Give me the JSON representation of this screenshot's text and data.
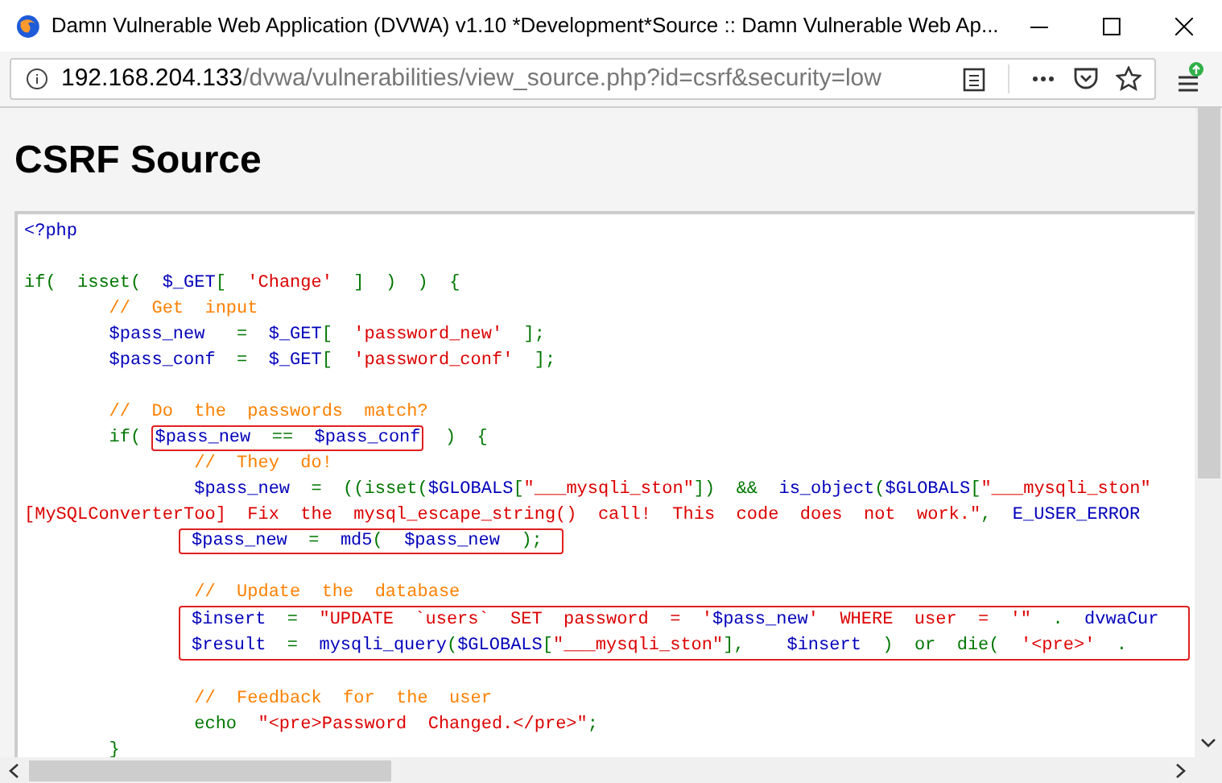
{
  "window": {
    "title": "Damn Vulnerable Web Application (DVWA) v1.10 *Development*Source :: Damn Vulnerable Web Ap..."
  },
  "address_bar": {
    "host": "192.168.204.133",
    "path": "/dvwa/vulnerabilities/view_source.php?id=csrf&security=low"
  },
  "page": {
    "heading": "CSRF Source",
    "code_lines": [
      {
        "kind": "line",
        "tokens": [
          {
            "text": "<?php",
            "kind": "default"
          }
        ]
      },
      {
        "kind": "blank"
      },
      {
        "kind": "line",
        "tokens": [
          {
            "text": "if(  isset(  ",
            "kind": "keyword"
          },
          {
            "text": "$_GET",
            "kind": "default"
          },
          {
            "text": "[  ",
            "kind": "keyword"
          },
          {
            "text": "'Change'",
            "kind": "string"
          },
          {
            "text": "  ]  )  )  {",
            "kind": "keyword"
          }
        ]
      },
      {
        "kind": "line",
        "tokens": [
          {
            "text": "        //  Get  input",
            "kind": "comment"
          }
        ]
      },
      {
        "kind": "line",
        "tokens": [
          {
            "text": "        $pass_new   ",
            "kind": "default"
          },
          {
            "text": "=  ",
            "kind": "keyword"
          },
          {
            "text": "$_GET",
            "kind": "default"
          },
          {
            "text": "[  ",
            "kind": "keyword"
          },
          {
            "text": "'password_new'",
            "kind": "string"
          },
          {
            "text": "  ];",
            "kind": "keyword"
          }
        ]
      },
      {
        "kind": "line",
        "tokens": [
          {
            "text": "        $pass_conf  ",
            "kind": "default"
          },
          {
            "text": "=  ",
            "kind": "keyword"
          },
          {
            "text": "$_GET",
            "kind": "default"
          },
          {
            "text": "[  ",
            "kind": "keyword"
          },
          {
            "text": "'password_conf'",
            "kind": "string"
          },
          {
            "text": "  ];",
            "kind": "keyword"
          }
        ]
      },
      {
        "kind": "blank"
      },
      {
        "kind": "line",
        "tokens": [
          {
            "text": "        //  Do  the  passwords  match?",
            "kind": "comment"
          }
        ]
      },
      {
        "kind": "line",
        "tokens": [
          {
            "text": "        if( ",
            "kind": "keyword"
          },
          {
            "kind": "box",
            "tokens": [
              {
                "text": "$pass_new  ",
                "kind": "default"
              },
              {
                "text": "==  ",
                "kind": "keyword"
              },
              {
                "text": "$pass_conf",
                "kind": "default"
              }
            ]
          },
          {
            "text": "  )  {",
            "kind": "keyword"
          }
        ]
      },
      {
        "kind": "line",
        "tokens": [
          {
            "text": "                //  They  do!",
            "kind": "comment"
          }
        ]
      },
      {
        "kind": "line",
        "tokens": [
          {
            "text": "                $pass_new  ",
            "kind": "default"
          },
          {
            "text": "=  ((",
            "kind": "keyword"
          },
          {
            "text": "isset",
            "kind": "keyword"
          },
          {
            "text": "(",
            "kind": "keyword"
          },
          {
            "text": "$GLOBALS",
            "kind": "default"
          },
          {
            "text": "[",
            "kind": "keyword"
          },
          {
            "text": "\"___mysqli_ston\"",
            "kind": "string"
          },
          {
            "text": "])  &&  ",
            "kind": "keyword"
          },
          {
            "text": "is_object",
            "kind": "default"
          },
          {
            "text": "(",
            "kind": "keyword"
          },
          {
            "text": "$GLOBALS",
            "kind": "default"
          },
          {
            "text": "[",
            "kind": "keyword"
          },
          {
            "text": "\"___mysqli_ston\"",
            "kind": "string"
          }
        ]
      },
      {
        "kind": "line",
        "tokens": [
          {
            "text": "[MySQLConverterToo]  Fix  the  mysql_escape_string()  call!  This  code  does  not  work.\"",
            "kind": "string"
          },
          {
            "text": ",  ",
            "kind": "keyword"
          },
          {
            "text": "E_USER_ERROR",
            "kind": "default"
          }
        ]
      },
      {
        "kind": "boxed_line",
        "tokens": [
          {
            "text": "$pass_new  ",
            "kind": "default"
          },
          {
            "text": "=  ",
            "kind": "keyword"
          },
          {
            "text": "md5",
            "kind": "default"
          },
          {
            "text": "(  ",
            "kind": "keyword"
          },
          {
            "text": "$pass_new  ",
            "kind": "default"
          },
          {
            "text": ");",
            "kind": "keyword"
          }
        ]
      },
      {
        "kind": "blank"
      },
      {
        "kind": "line",
        "tokens": [
          {
            "text": "                //  Update  the  database",
            "kind": "comment"
          }
        ]
      },
      {
        "kind": "boxed_block",
        "lines": [
          {
            "kind": "line",
            "tokens": [
              {
                "text": "$insert  ",
                "kind": "default"
              },
              {
                "text": "=  ",
                "kind": "keyword"
              },
              {
                "text": "\"UPDATE  `users`  SET  password  =  '",
                "kind": "string"
              },
              {
                "text": "$pass_new",
                "kind": "default"
              },
              {
                "text": "'  WHERE  user  =  '\"",
                "kind": "string"
              },
              {
                "text": "  .  ",
                "kind": "keyword"
              },
              {
                "text": "dvwaCur",
                "kind": "default"
              }
            ]
          },
          {
            "kind": "line",
            "tokens": [
              {
                "text": "$result  ",
                "kind": "default"
              },
              {
                "text": "=  ",
                "kind": "keyword"
              },
              {
                "text": "mysqli_query",
                "kind": "default"
              },
              {
                "text": "(",
                "kind": "keyword"
              },
              {
                "text": "$GLOBALS",
                "kind": "default"
              },
              {
                "text": "[",
                "kind": "keyword"
              },
              {
                "text": "\"___mysqli_ston\"",
                "kind": "string"
              },
              {
                "text": "],    ",
                "kind": "keyword"
              },
              {
                "text": "$insert  ",
                "kind": "default"
              },
              {
                "text": ")  or  die(  ",
                "kind": "keyword"
              },
              {
                "text": "'<pre>'",
                "kind": "string"
              },
              {
                "text": "  .",
                "kind": "keyword"
              }
            ]
          }
        ]
      },
      {
        "kind": "blank"
      },
      {
        "kind": "line",
        "tokens": [
          {
            "text": "                //  Feedback  for  the  user",
            "kind": "comment"
          }
        ]
      },
      {
        "kind": "line",
        "tokens": [
          {
            "text": "                echo  ",
            "kind": "keyword"
          },
          {
            "text": "\"<pre>Password  Changed.</pre>\"",
            "kind": "string"
          },
          {
            "text": ";",
            "kind": "keyword"
          }
        ]
      },
      {
        "kind": "line",
        "tokens": [
          {
            "text": "        }",
            "kind": "keyword"
          }
        ]
      }
    ]
  }
}
